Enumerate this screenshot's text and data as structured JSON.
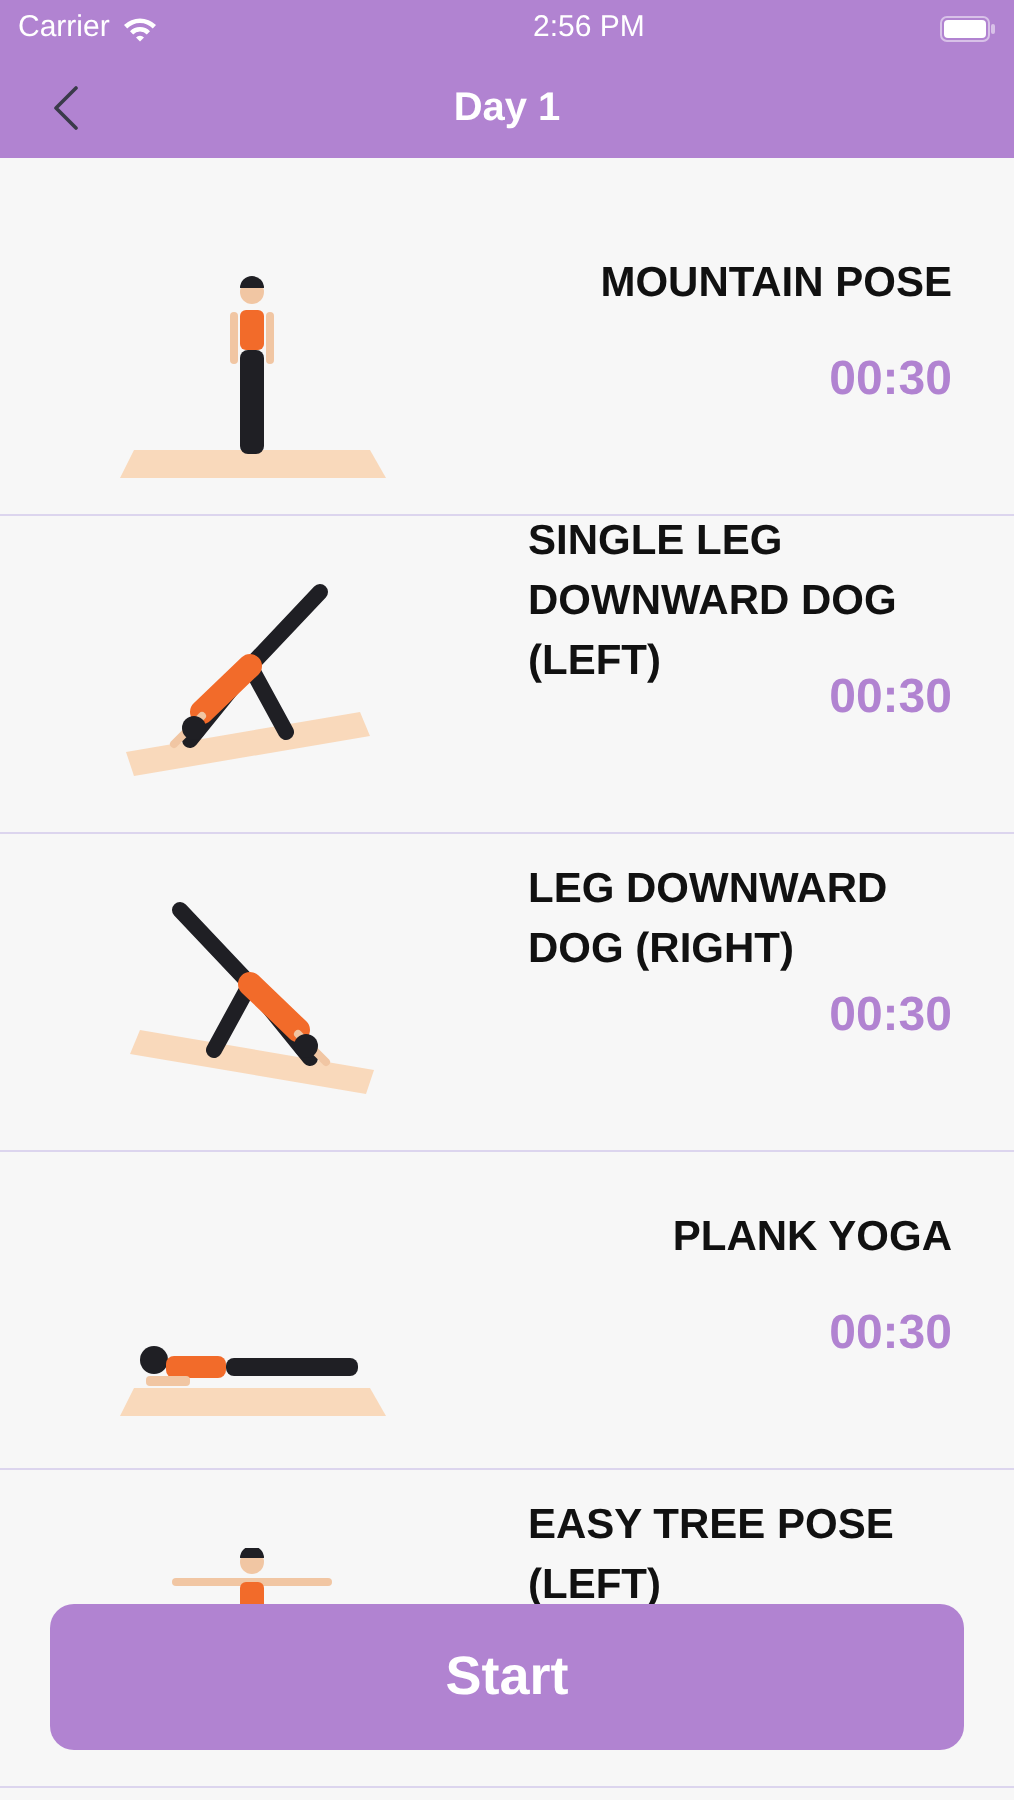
{
  "status_bar": {
    "carrier": "Carrier",
    "time": "2:56 PM"
  },
  "nav": {
    "title": "Day 1"
  },
  "exercises": [
    {
      "name": "MOUNTAIN POSE",
      "duration": "00:30"
    },
    {
      "name": "SINGLE LEG DOWNWARD DOG (LEFT)",
      "duration": "00:30"
    },
    {
      "name": "LEG DOWNWARD DOG (RIGHT)",
      "duration": "00:30"
    },
    {
      "name": "PLANK YOGA",
      "duration": "00:30"
    },
    {
      "name": "EASY TREE POSE (LEFT)"
    }
  ],
  "start_button": {
    "label": "Start"
  }
}
